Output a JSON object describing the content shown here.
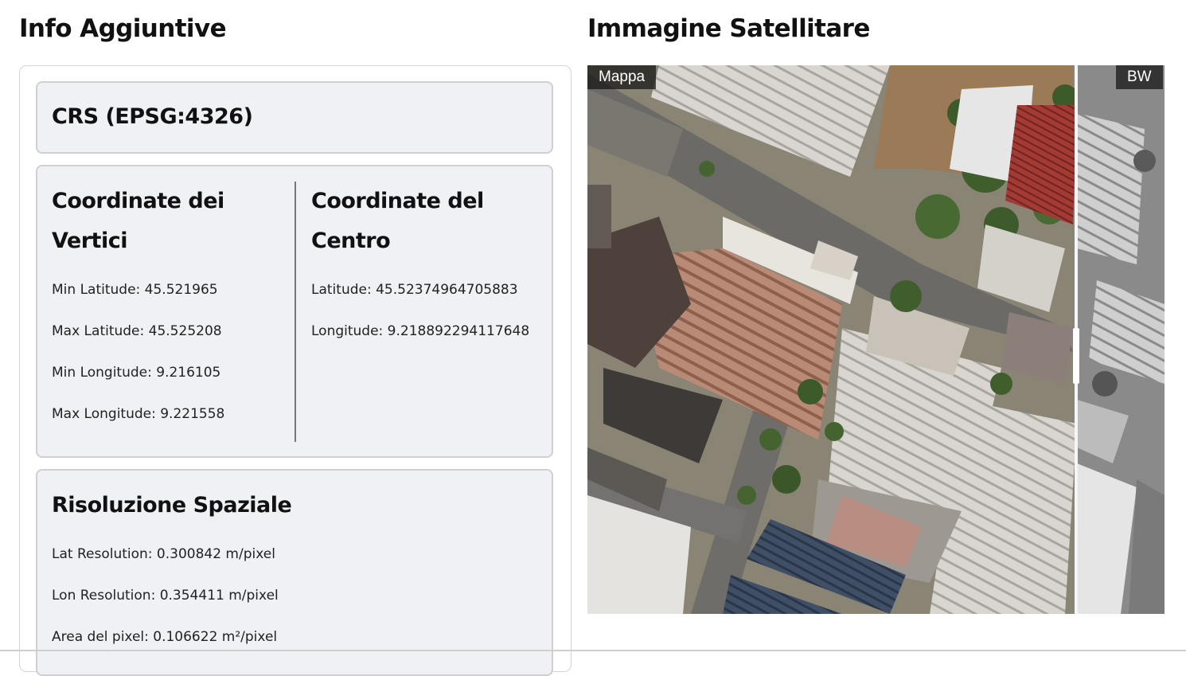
{
  "left_panel": {
    "heading": "Info Aggiuntive",
    "crs": {
      "title": "CRS (EPSG:4326)"
    },
    "vertices": {
      "title_line1": "Coordinate dei",
      "title_line2": "Vertici",
      "min_lat": "Min Latitude: 45.521965",
      "max_lat": "Max Latitude: 45.525208",
      "min_lon": "Min Longitude: 9.216105",
      "max_lon": "Max Longitude: 9.221558"
    },
    "center": {
      "title_line1": "Coordinate del",
      "title_line2": "Centro",
      "lat": "Latitude: 45.52374964705883",
      "lon": "Longitude: 9.218892294117648"
    },
    "resolution": {
      "title": "Risoluzione Spaziale",
      "lat_res": "Lat Resolution: 0.300842 m/pixel",
      "lon_res": "Lon Resolution: 0.354411 m/pixel",
      "pixel_area": "Area del pixel: 0.106622 m²/pixel"
    }
  },
  "right_panel": {
    "heading": "Immagine Satellitare",
    "left_label": "Mappa",
    "right_label": "BW",
    "slider_position": 0.848
  }
}
